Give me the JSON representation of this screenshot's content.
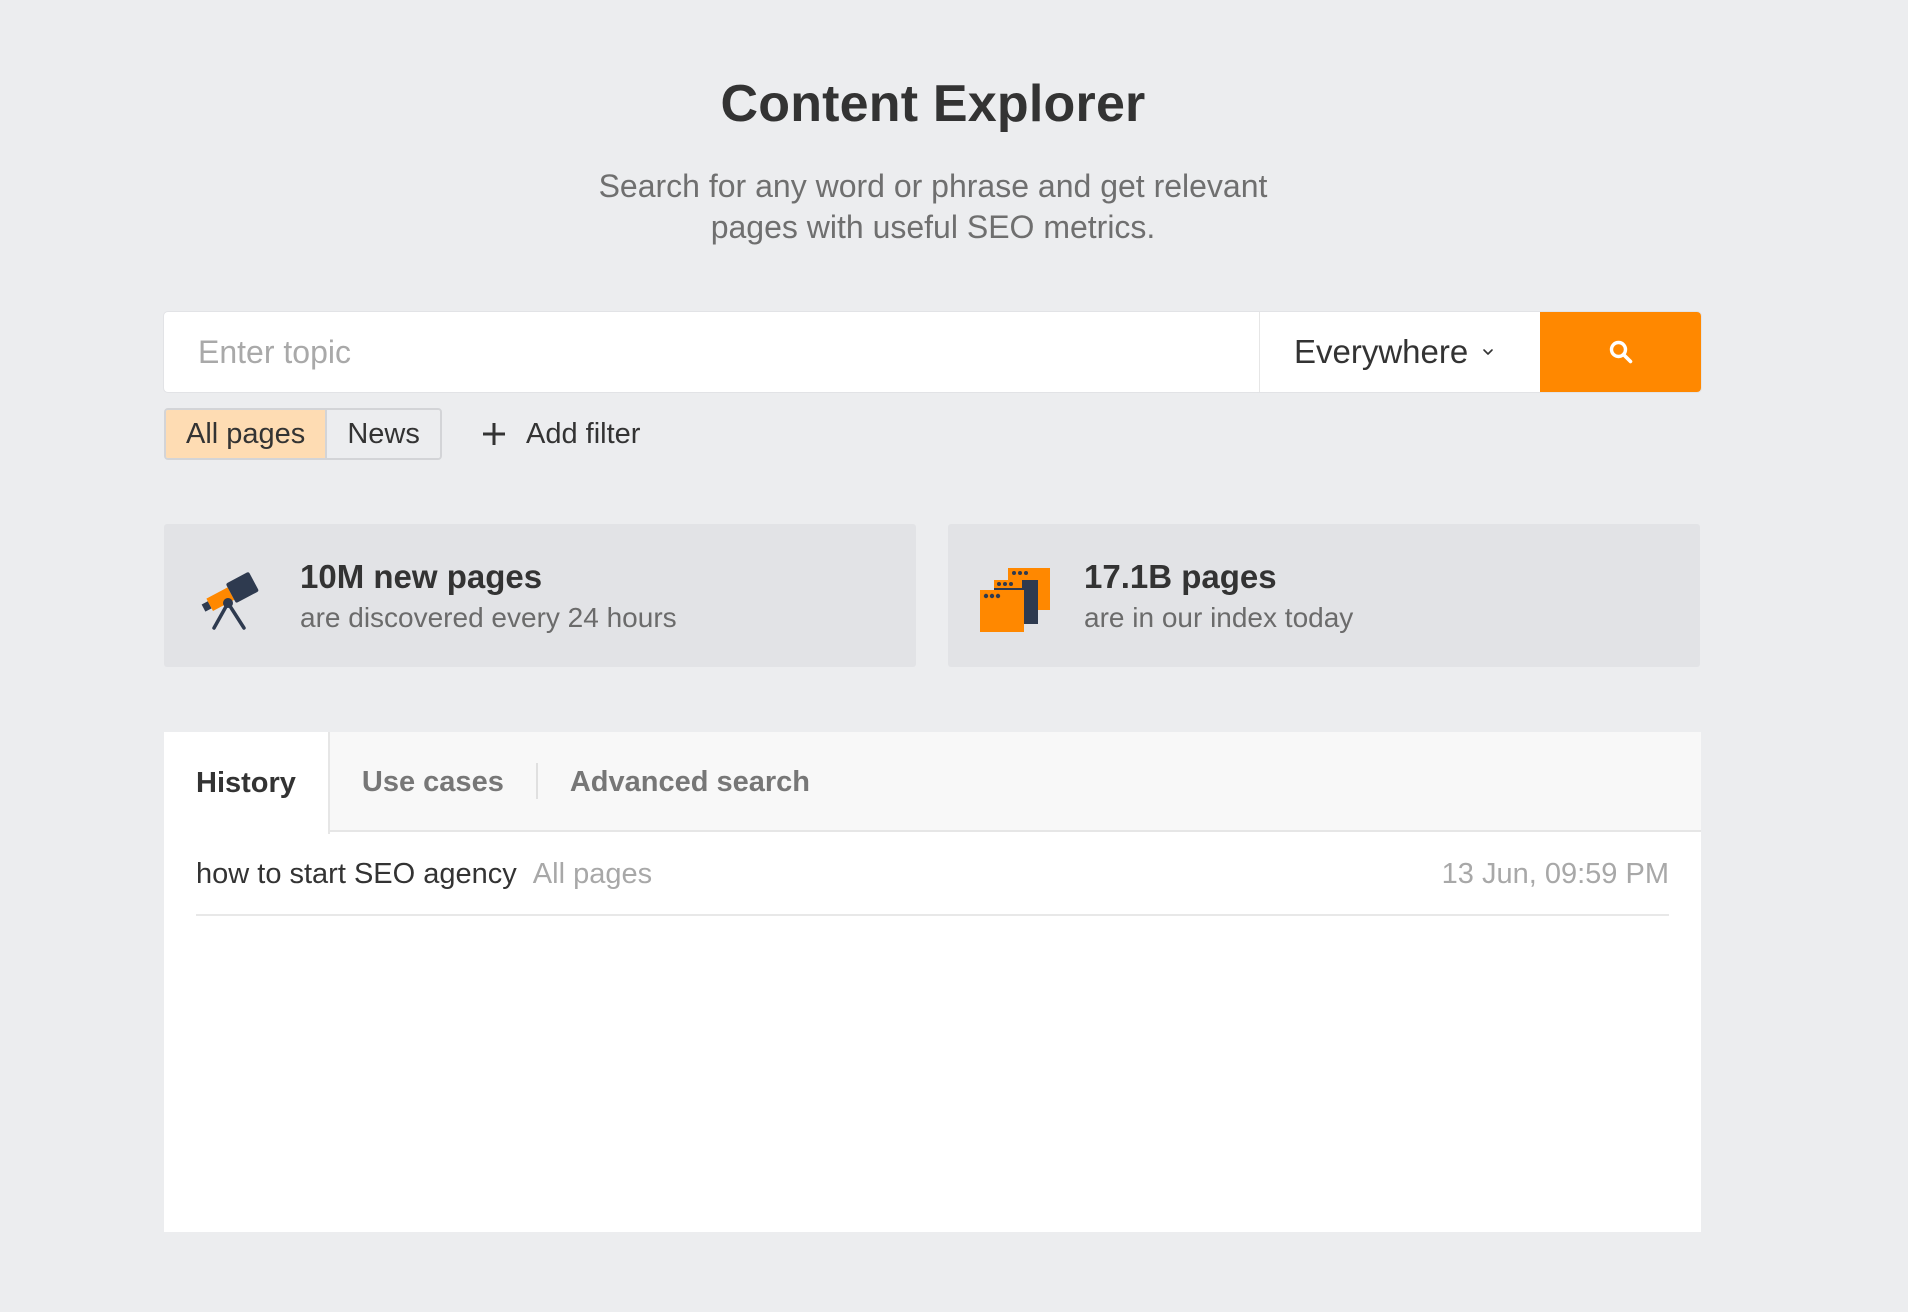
{
  "header": {
    "title": "Content Explorer",
    "subtitle_line1": "Search for any word or phrase and get relevant",
    "subtitle_line2": "pages with useful SEO metrics."
  },
  "search": {
    "placeholder": "Enter topic",
    "value": "",
    "scope_selected": "Everywhere",
    "button_icon": "search-icon"
  },
  "filters": {
    "options": [
      "All pages",
      "News"
    ],
    "active": "All pages",
    "add_filter_label": "Add filter"
  },
  "stats": [
    {
      "icon": "telescope-icon",
      "headline": "10M new pages",
      "caption": "are discovered every 24 hours"
    },
    {
      "icon": "stacked-windows-icon",
      "headline": "17.1B pages",
      "caption": "are in our index today"
    }
  ],
  "tabs": {
    "items": [
      "History",
      "Use cases",
      "Advanced search"
    ],
    "active": "History"
  },
  "history": [
    {
      "query": "how to start SEO agency",
      "scope": "All pages",
      "time": "13 Jun, 09:59 PM"
    }
  ],
  "colors": {
    "accent": "#ff8800",
    "accent_light": "#fedcb3",
    "icon_dark": "#2e3a4f",
    "background": "#ecedef"
  }
}
